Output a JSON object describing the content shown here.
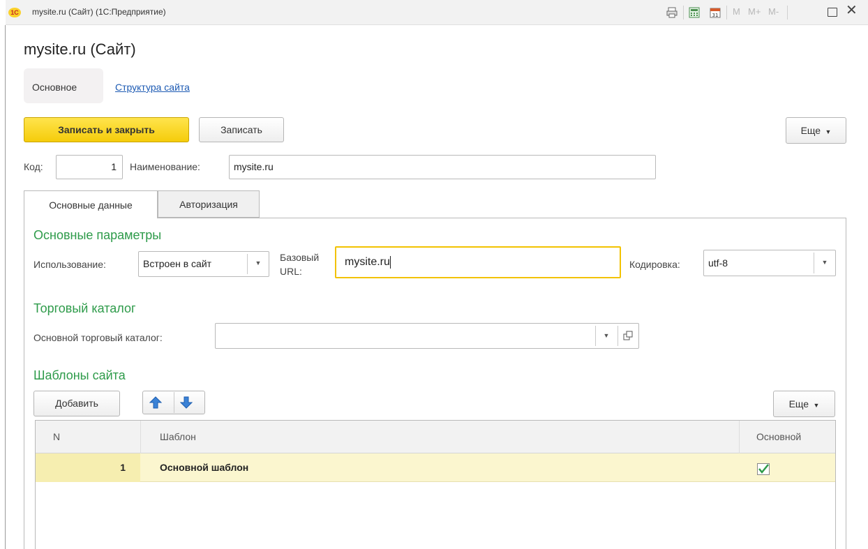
{
  "window": {
    "title": "mysite.ru (Сайт) (1С:Предприятие)",
    "logo": "1С",
    "memory_buttons": [
      "M",
      "M+",
      "M-"
    ]
  },
  "page": {
    "title": "mysite.ru (Сайт)"
  },
  "nav": {
    "active": "Основное",
    "link": "Структура сайта"
  },
  "toolbar": {
    "save_close": "Записать и закрыть",
    "save": "Записать",
    "more": "Еще"
  },
  "header_fields": {
    "code_label": "Код:",
    "code_value": "1",
    "name_label": "Наименование:",
    "name_value": "mysite.ru"
  },
  "tabs": [
    {
      "label": "Основные данные",
      "active": true
    },
    {
      "label": "Авторизация",
      "active": false
    }
  ],
  "main_params": {
    "title": "Основные параметры",
    "usage_label": "Использование:",
    "usage_value": "Встроен в сайт",
    "base_url_label_1": "Базовый",
    "base_url_label_2": "URL:",
    "base_url_value": "mysite.ru",
    "encoding_label": "Кодировка:",
    "encoding_value": "utf-8"
  },
  "catalog": {
    "title": "Торговый каталог",
    "main_label": "Основной торговый каталог:",
    "main_value": ""
  },
  "templates": {
    "title": "Шаблоны сайта",
    "add": "Добавить",
    "more": "Еще",
    "columns": [
      "N",
      "Шаблон",
      "Основной"
    ],
    "rows": [
      {
        "n": "1",
        "name": "Основной шаблон",
        "main": true
      }
    ]
  },
  "colors": {
    "accent_yellow": "#f5cc0a",
    "section_green": "#2e9b4a",
    "link_blue": "#1c5ab3",
    "focus_border": "#f2c200",
    "row_highlight": "#fbf6cf"
  }
}
